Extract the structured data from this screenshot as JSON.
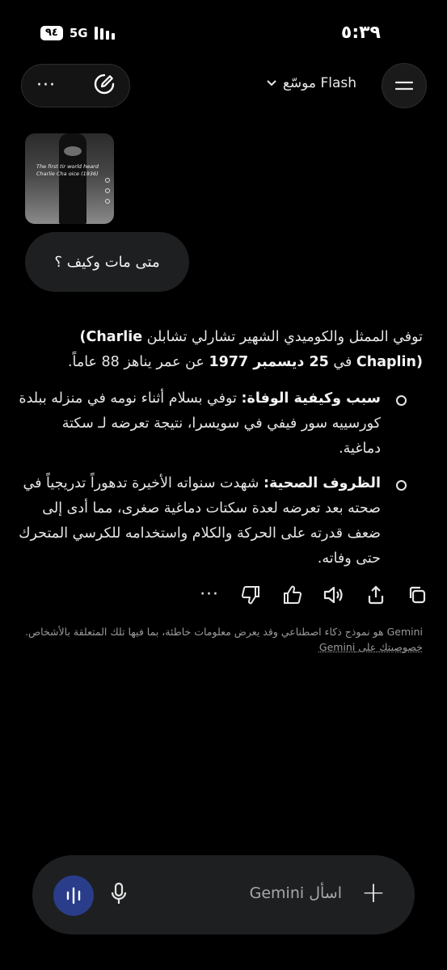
{
  "status": {
    "time": "٥:٣٩",
    "battery": "٩٤",
    "network": "5G"
  },
  "header": {
    "model_label": "Flash موسّع",
    "more_icon": "more-horizontal-icon",
    "new_chat_icon": "edit-pencil-icon",
    "menu_icon": "hamburger-menu-icon",
    "chevron_icon": "chevron-down-icon"
  },
  "thumbnail": {
    "caption_line1": "The first tir      world heard",
    "caption_line2": "Charlie Cha      oice (1936)"
  },
  "user_message": "متى مات وكيف ؟",
  "response": {
    "intro_a": "توفي الممثل والكوميدي الشهير تشارلي تشابلن ",
    "intro_name": "(Charlie Chaplin)",
    "intro_b": " في ",
    "intro_date": "25 ديسمبر 1977",
    "intro_c": " عن عمر يناهز 88 عاماً.",
    "bullets": [
      {
        "label": "سبب وكيفية الوفاة:",
        "text": " توفي بسلام أثناء نومه في منزله ببلدة كورسييه سور فيفي في سويسرا، نتيجة تعرضه لـ سكتة دماغية."
      },
      {
        "label": "الظروف الصحية:",
        "text": " شهدت سنواته الأخيرة تدهوراً تدريجياً في صحته بعد تعرضه لعدة سكتات دماغية صغرى، مما أدى إلى ضعف قدرته على الحركة والكلام واستخدامه للكرسي المتحرك حتى وفاته."
      }
    ]
  },
  "actions": {
    "copy_icon": "copy-icon",
    "share_icon": "share-icon",
    "listen_icon": "speaker-icon",
    "like_icon": "thumbs-up-icon",
    "dislike_icon": "thumbs-down-icon",
    "more_icon": "more-horizontal-icon",
    "more_label": "···"
  },
  "disclaimer": {
    "text": "Gemini هو نموذج ذكاء اصطناعي وقد يعرض معلومات خاطئة، بما فيها تلك المتعلقة بالأشخاص. ",
    "link": "خصوصيتك على Gemini"
  },
  "composer": {
    "placeholder": "اسأل Gemini",
    "add_icon": "plus-icon",
    "mic_icon": "microphone-icon",
    "live_icon": "live-waveform-icon",
    "accent": "#2a3d8a"
  }
}
